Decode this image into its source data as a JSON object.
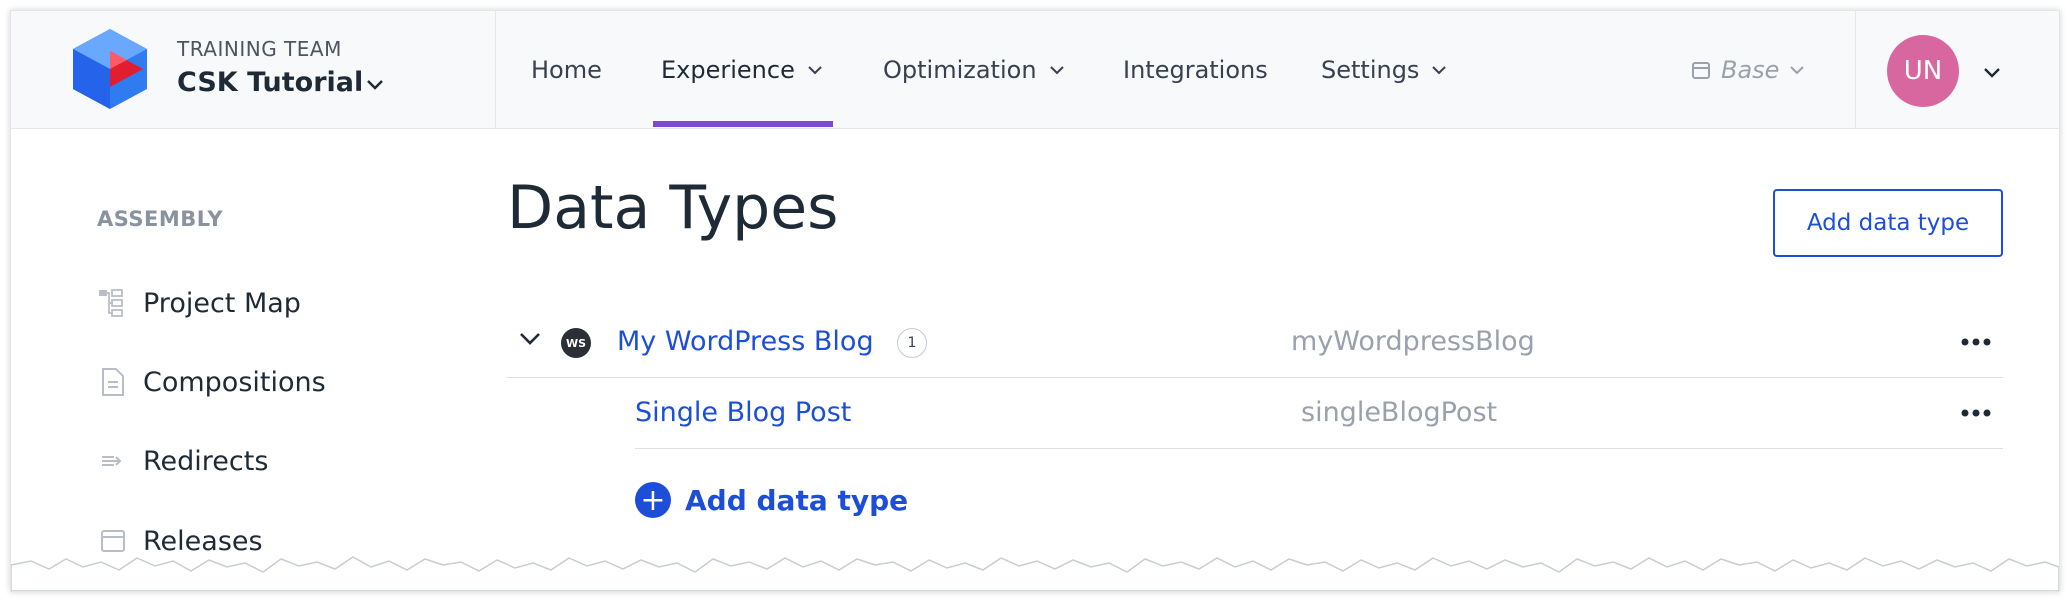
{
  "header": {
    "team_label": "TRAINING TEAM",
    "project_name": "CSK Tutorial",
    "nav": [
      {
        "label": "Home",
        "has_dropdown": false
      },
      {
        "label": "Experience",
        "has_dropdown": true,
        "active": true
      },
      {
        "label": "Optimization",
        "has_dropdown": true
      },
      {
        "label": "Integrations",
        "has_dropdown": false
      },
      {
        "label": "Settings",
        "has_dropdown": true
      }
    ],
    "environment": "Base",
    "avatar_initials": "UN"
  },
  "sidebar": {
    "heading": "ASSEMBLY",
    "items": [
      {
        "label": "Project Map",
        "icon": "project-map-icon"
      },
      {
        "label": "Compositions",
        "icon": "document-icon"
      },
      {
        "label": "Redirects",
        "icon": "redirect-icon"
      },
      {
        "label": "Releases",
        "icon": "release-icon"
      }
    ]
  },
  "main": {
    "title": "Data Types",
    "add_button_label": "Add data type",
    "source": {
      "badge": "WS",
      "name": "My WordPress Blog",
      "count": "1",
      "key": "myWordpressBlog"
    },
    "data_types": [
      {
        "name": "Single Blog Post",
        "key": "singleBlogPost"
      }
    ],
    "add_inline_label": "Add data type"
  },
  "colors": {
    "accent_blue": "#1d4ed8",
    "nav_active_underline": "#7a4bd1",
    "avatar_bg": "#d9679f",
    "muted_text": "#9aa1ac"
  }
}
